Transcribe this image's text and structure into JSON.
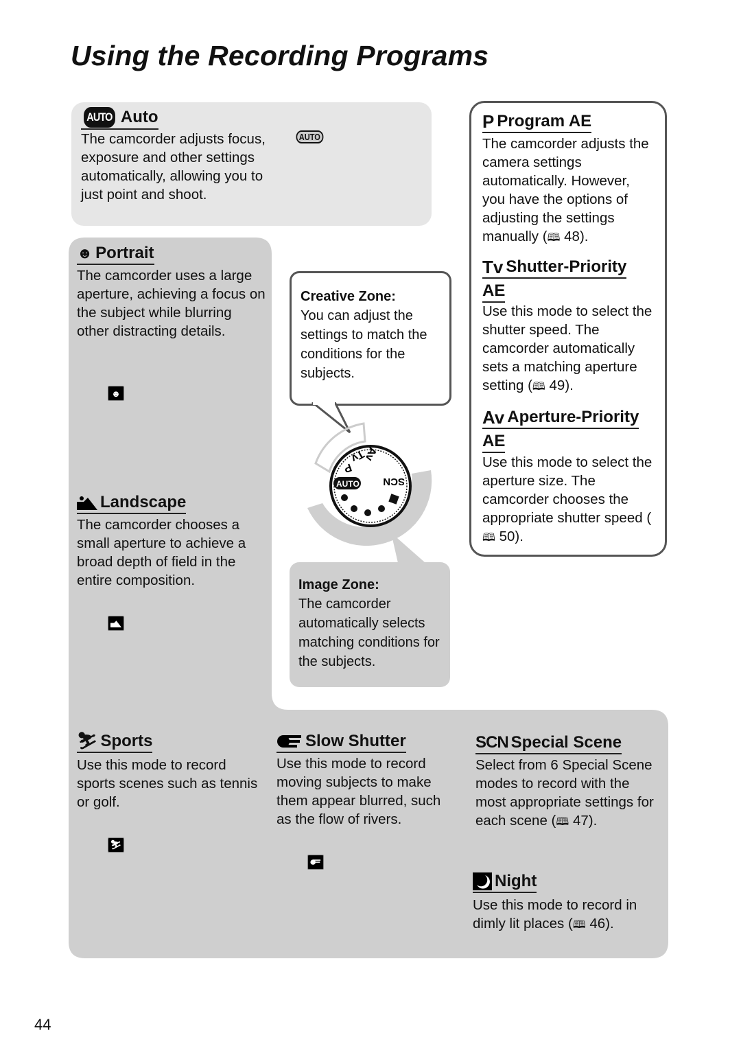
{
  "page": {
    "title": "Using the Recording Programs",
    "page_number": "44"
  },
  "auto": {
    "icon": "auto-icon",
    "icon_text": "AUTO",
    "heading": "Auto",
    "text": "The camcorder adjusts focus, exposure and other settings automatically, allowing you to just point and shoot."
  },
  "program": {
    "icon_text": "P",
    "heading": "Program AE",
    "text": "The camcorder adjusts the camera settings automatically. However, you have the options of adjusting the settings manually (",
    "ref": "48",
    "text_end": ")."
  },
  "shutter": {
    "icon_text": "Tv",
    "heading": "Shutter-Priority AE",
    "text": "Use this mode to select the shutter speed. The camcorder automatically sets a matching aperture setting (",
    "ref": "49",
    "text_end": ")."
  },
  "aperture": {
    "icon_text": "Av",
    "heading": "Aperture-Priority AE",
    "text": "Use this mode to select the aperture size. The camcorder chooses the appropriate shutter speed (",
    "ref": "50",
    "text_end": ")."
  },
  "portrait": {
    "heading": "Portrait",
    "text": "The camcorder uses a large aperture, achieving a focus on the subject while blurring other distracting details."
  },
  "landscape": {
    "heading": "Landscape",
    "text": "The camcorder chooses a small aperture to achieve a broad depth of field in the entire composition."
  },
  "creative_zone": {
    "label": "Creative Zone:",
    "text": "You can adjust the settings to match the conditions for the subjects."
  },
  "image_zone": {
    "label": "Image Zone:",
    "text": "The camcorder automatically selects matching conditions for the subjects."
  },
  "dial": {
    "labels": [
      "AUTO",
      "P",
      "Tv",
      "Av",
      "SCN"
    ]
  },
  "sports": {
    "heading": "Sports",
    "text": "Use this mode to record sports scenes such as tennis or golf."
  },
  "slow_shutter": {
    "heading": "Slow Shutter",
    "text": "Use this mode to record moving subjects to make them appear blurred, such as the flow of rivers."
  },
  "special_scene": {
    "icon_text": "SCN",
    "heading": "Special Scene",
    "text": "Select from 6 Special Scene modes to record with the most appropriate settings for each scene (",
    "ref": "47",
    "text_end": ")."
  },
  "night": {
    "heading": "Night",
    "text": "Use this mode to record in dimly lit places (",
    "ref": "46",
    "text_end": ")."
  },
  "colors": {
    "panel_gray": "#cfcfcf",
    "auto_panel": "#e6e6e6",
    "border": "#555555"
  }
}
